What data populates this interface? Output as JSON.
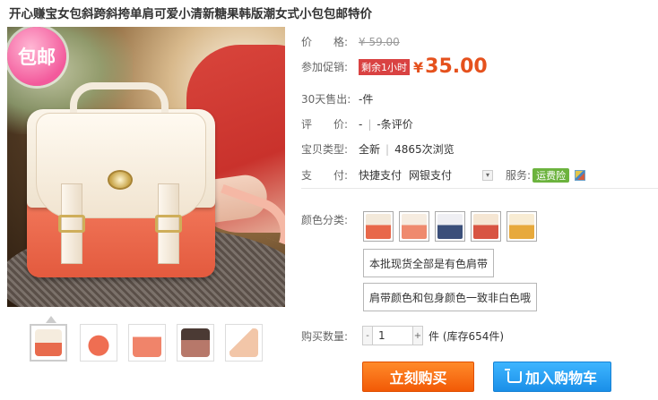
{
  "title": "开心赚宝女包斜跨斜挎单肩可爱小清新糖果韩版潮女式小包包邮特价",
  "image": {
    "badge": "包邮"
  },
  "price": {
    "label": "价　　格:",
    "original": "¥ 59.00"
  },
  "promo": {
    "label": "参加促销:",
    "tag": "剩余1小时",
    "yen": "¥",
    "amount": "35.00"
  },
  "sales": {
    "label": "30天售出:",
    "value": "-件"
  },
  "review": {
    "label": "评　　价:",
    "score": "-",
    "divider": "|",
    "count": "-条评价"
  },
  "item_type": {
    "label": "宝贝类型:",
    "condition": "全新",
    "divider": "|",
    "views": "4865次浏览"
  },
  "payment": {
    "label": "支　　付:",
    "options": [
      "快捷支付",
      "网银支付"
    ],
    "service_label": "服务:",
    "service_badge": "运费险"
  },
  "color": {
    "label": "颜色分类:",
    "swatches": [
      {
        "name": "orange-white",
        "color_top": "#f3e9da",
        "color_bottom": "#e8684a"
      },
      {
        "name": "coral-cream",
        "color_top": "#f6ece0",
        "color_bottom": "#ef8a6e"
      },
      {
        "name": "navy-white",
        "color_top": "#efeff3",
        "color_bottom": "#3b4f7a"
      },
      {
        "name": "red-cream",
        "color_top": "#f5e6d3",
        "color_bottom": "#d85442"
      },
      {
        "name": "yellow-cream",
        "color_top": "#f8ecd3",
        "color_bottom": "#e7a93c"
      }
    ],
    "options": [
      "本批现货全部是有色肩带",
      "肩带颜色和包身颜色一致非白色哦"
    ]
  },
  "quantity": {
    "label": "购买数量:",
    "minus": "-",
    "value": "1",
    "plus": "+",
    "stock": "件 (库存654件)"
  },
  "buttons": {
    "buy": "立刻购买",
    "cart": "加入购物车"
  },
  "thumbnails": [
    {
      "name": "thumb-1",
      "color": "#e86b4d"
    },
    {
      "name": "thumb-2",
      "color": "#ef6e52"
    },
    {
      "name": "thumb-3",
      "color": "#f0846a"
    },
    {
      "name": "thumb-4",
      "color": "#b7786a"
    },
    {
      "name": "thumb-5",
      "color": "#f2c6a8"
    }
  ]
}
